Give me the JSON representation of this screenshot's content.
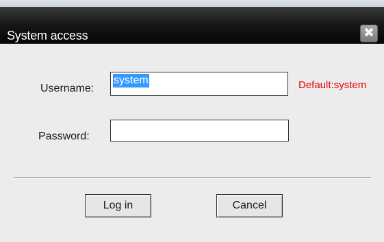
{
  "window": {
    "title": "System access",
    "close_symbol": "✖",
    "close_icon": "close-icon"
  },
  "form": {
    "username_label": "Username:",
    "username_value": "system",
    "username_hint": "Default:system",
    "password_label": "Password:",
    "password_value": ""
  },
  "buttons": {
    "login_label": "Log in",
    "cancel_label": "Cancel"
  },
  "colors": {
    "hint": "#e8000a",
    "selection": "#3399ff",
    "titlebar": "#181818"
  }
}
